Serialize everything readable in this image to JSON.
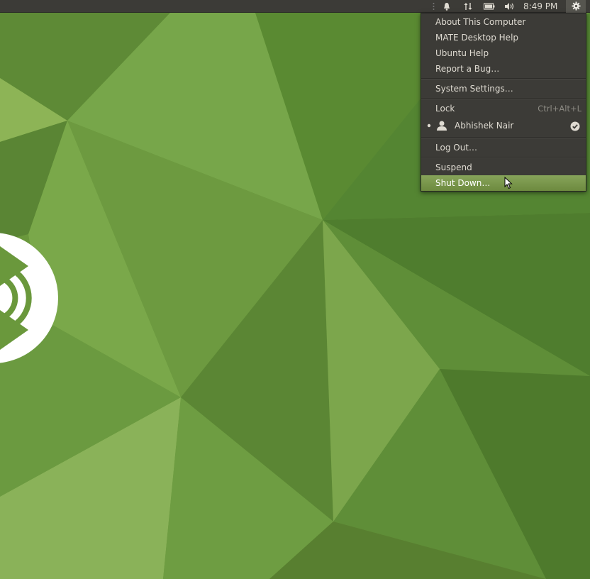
{
  "topbar": {
    "clock": "8:49 PM",
    "icons": [
      "notification-bell-icon",
      "network-arrows-icon",
      "battery-icon",
      "volume-icon",
      "gear-icon"
    ]
  },
  "menu": {
    "items": [
      {
        "label": "About This Computer"
      },
      {
        "label": "MATE Desktop Help"
      },
      {
        "label": "Ubuntu Help"
      },
      {
        "label": "Report a Bug…"
      },
      {
        "label": "System Settings…"
      },
      {
        "label": "Lock",
        "accel": "Ctrl+Alt+L"
      },
      {
        "label": "Abhishek Nair"
      },
      {
        "label": "Log Out…"
      },
      {
        "label": "Suspend"
      },
      {
        "label": "Shut Down…"
      }
    ]
  },
  "colors": {
    "panel": "#3c3b37",
    "highlight": "#7a9a4a",
    "wallpaper_base": "#6a9a3e"
  }
}
